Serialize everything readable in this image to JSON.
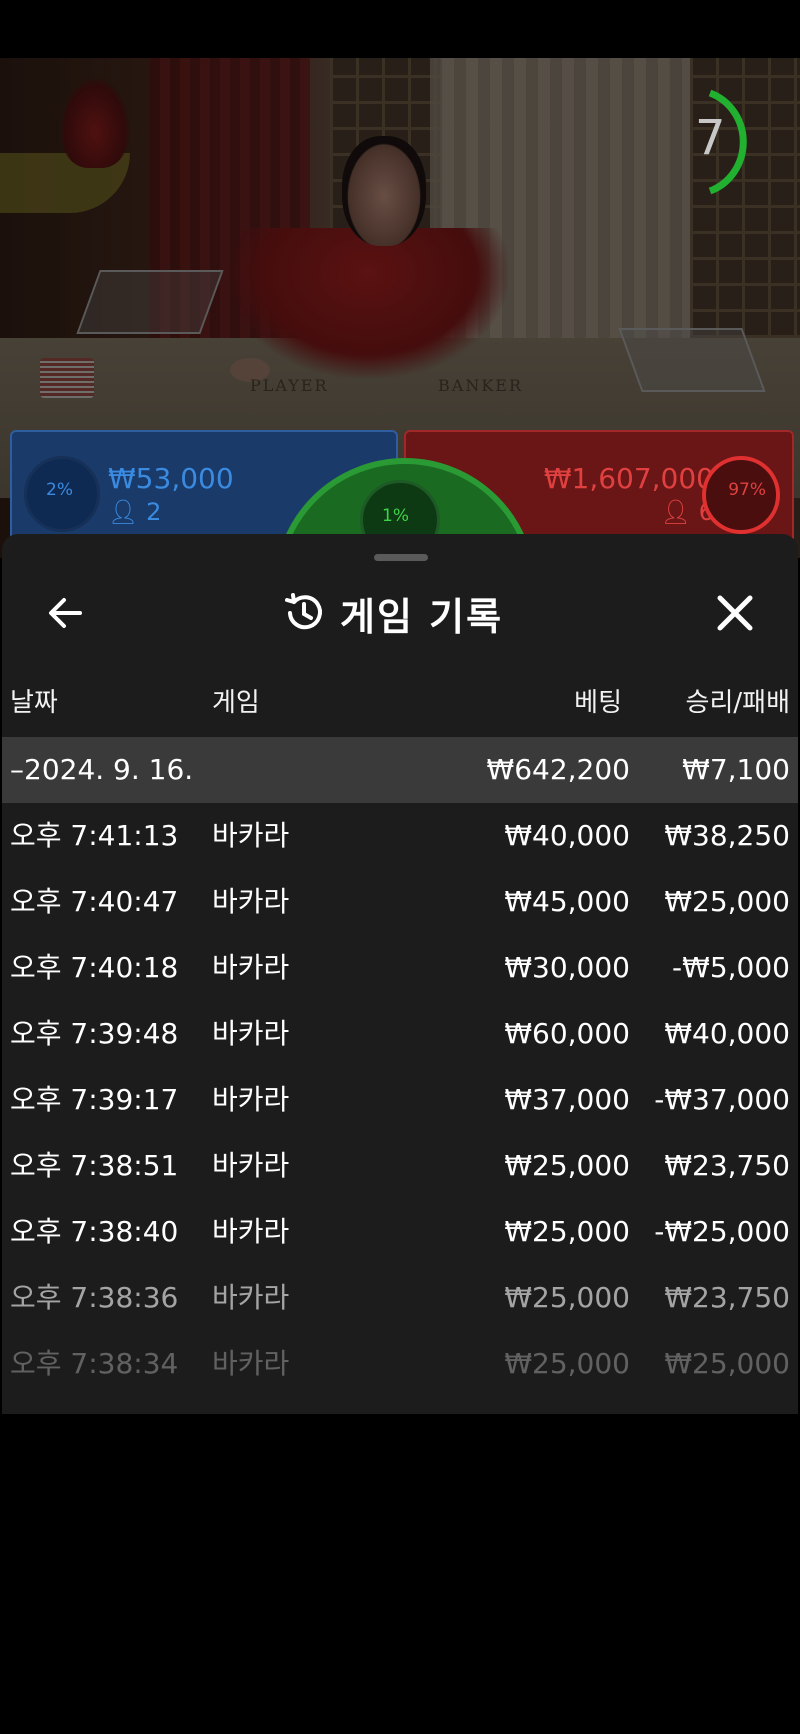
{
  "stream": {
    "timer_value": "7",
    "table_labels": [
      "PLAYER",
      "BANKER"
    ],
    "player": {
      "percent": "2%",
      "amount": "₩53,000",
      "players": "2"
    },
    "banker": {
      "percent": "97%",
      "amount": "₩1,607,000",
      "players": "6"
    },
    "tie": {
      "percent": "1%"
    },
    "colors": {
      "player": "#2e6fd0",
      "banker": "#e03030",
      "tie": "#2eb83a",
      "timer": "#21b02f"
    }
  },
  "history": {
    "title": "게임 기록",
    "icons": {
      "back": "arrow-left-icon",
      "history": "history-clock-icon",
      "close": "close-icon"
    },
    "columns": {
      "date": "날짜",
      "game": "게임",
      "bet": "베팅",
      "result": "승리/패배"
    },
    "date_group": {
      "label": "–2024. 9. 16.",
      "bet_total": "₩642,200",
      "result_total": "₩7,100"
    },
    "rows": [
      {
        "time": "오후 7:41:13",
        "game": "바카라",
        "bet": "₩40,000",
        "result": "₩38,250"
      },
      {
        "time": "오후 7:40:47",
        "game": "바카라",
        "bet": "₩45,000",
        "result": "₩25,000"
      },
      {
        "time": "오후 7:40:18",
        "game": "바카라",
        "bet": "₩30,000",
        "result": "-₩5,000"
      },
      {
        "time": "오후 7:39:48",
        "game": "바카라",
        "bet": "₩60,000",
        "result": "₩40,000"
      },
      {
        "time": "오후 7:39:17",
        "game": "바카라",
        "bet": "₩37,000",
        "result": "-₩37,000"
      },
      {
        "time": "오후 7:38:51",
        "game": "바카라",
        "bet": "₩25,000",
        "result": "₩23,750"
      },
      {
        "time": "오후 7:38:40",
        "game": "바카라",
        "bet": "₩25,000",
        "result": "-₩25,000"
      },
      {
        "time": "오후 7:38:36",
        "game": "바카라",
        "bet": "₩25,000",
        "result": "₩23,750"
      },
      {
        "time": "오후 7:38:34",
        "game": "바카라",
        "bet": "₩25,000",
        "result": "₩25,000"
      }
    ]
  }
}
